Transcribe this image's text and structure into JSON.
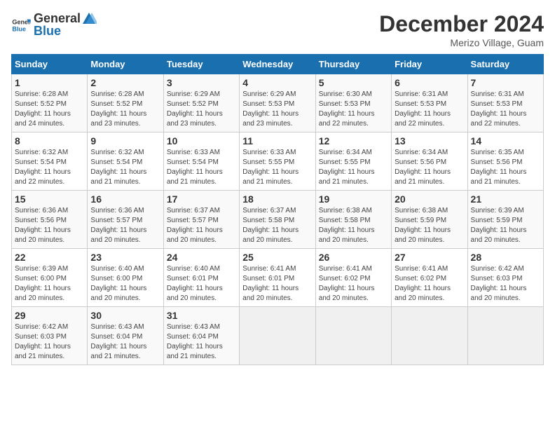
{
  "header": {
    "logo_general": "General",
    "logo_blue": "Blue",
    "month": "December 2024",
    "location": "Merizo Village, Guam"
  },
  "weekdays": [
    "Sunday",
    "Monday",
    "Tuesday",
    "Wednesday",
    "Thursday",
    "Friday",
    "Saturday"
  ],
  "weeks": [
    [
      {
        "day": "1",
        "info": "Sunrise: 6:28 AM\nSunset: 5:52 PM\nDaylight: 11 hours\nand 24 minutes."
      },
      {
        "day": "2",
        "info": "Sunrise: 6:28 AM\nSunset: 5:52 PM\nDaylight: 11 hours\nand 23 minutes."
      },
      {
        "day": "3",
        "info": "Sunrise: 6:29 AM\nSunset: 5:52 PM\nDaylight: 11 hours\nand 23 minutes."
      },
      {
        "day": "4",
        "info": "Sunrise: 6:29 AM\nSunset: 5:53 PM\nDaylight: 11 hours\nand 23 minutes."
      },
      {
        "day": "5",
        "info": "Sunrise: 6:30 AM\nSunset: 5:53 PM\nDaylight: 11 hours\nand 22 minutes."
      },
      {
        "day": "6",
        "info": "Sunrise: 6:31 AM\nSunset: 5:53 PM\nDaylight: 11 hours\nand 22 minutes."
      },
      {
        "day": "7",
        "info": "Sunrise: 6:31 AM\nSunset: 5:53 PM\nDaylight: 11 hours\nand 22 minutes."
      }
    ],
    [
      {
        "day": "8",
        "info": "Sunrise: 6:32 AM\nSunset: 5:54 PM\nDaylight: 11 hours\nand 22 minutes."
      },
      {
        "day": "9",
        "info": "Sunrise: 6:32 AM\nSunset: 5:54 PM\nDaylight: 11 hours\nand 21 minutes."
      },
      {
        "day": "10",
        "info": "Sunrise: 6:33 AM\nSunset: 5:54 PM\nDaylight: 11 hours\nand 21 minutes."
      },
      {
        "day": "11",
        "info": "Sunrise: 6:33 AM\nSunset: 5:55 PM\nDaylight: 11 hours\nand 21 minutes."
      },
      {
        "day": "12",
        "info": "Sunrise: 6:34 AM\nSunset: 5:55 PM\nDaylight: 11 hours\nand 21 minutes."
      },
      {
        "day": "13",
        "info": "Sunrise: 6:34 AM\nSunset: 5:56 PM\nDaylight: 11 hours\nand 21 minutes."
      },
      {
        "day": "14",
        "info": "Sunrise: 6:35 AM\nSunset: 5:56 PM\nDaylight: 11 hours\nand 21 minutes."
      }
    ],
    [
      {
        "day": "15",
        "info": "Sunrise: 6:36 AM\nSunset: 5:56 PM\nDaylight: 11 hours\nand 20 minutes."
      },
      {
        "day": "16",
        "info": "Sunrise: 6:36 AM\nSunset: 5:57 PM\nDaylight: 11 hours\nand 20 minutes."
      },
      {
        "day": "17",
        "info": "Sunrise: 6:37 AM\nSunset: 5:57 PM\nDaylight: 11 hours\nand 20 minutes."
      },
      {
        "day": "18",
        "info": "Sunrise: 6:37 AM\nSunset: 5:58 PM\nDaylight: 11 hours\nand 20 minutes."
      },
      {
        "day": "19",
        "info": "Sunrise: 6:38 AM\nSunset: 5:58 PM\nDaylight: 11 hours\nand 20 minutes."
      },
      {
        "day": "20",
        "info": "Sunrise: 6:38 AM\nSunset: 5:59 PM\nDaylight: 11 hours\nand 20 minutes."
      },
      {
        "day": "21",
        "info": "Sunrise: 6:39 AM\nSunset: 5:59 PM\nDaylight: 11 hours\nand 20 minutes."
      }
    ],
    [
      {
        "day": "22",
        "info": "Sunrise: 6:39 AM\nSunset: 6:00 PM\nDaylight: 11 hours\nand 20 minutes."
      },
      {
        "day": "23",
        "info": "Sunrise: 6:40 AM\nSunset: 6:00 PM\nDaylight: 11 hours\nand 20 minutes."
      },
      {
        "day": "24",
        "info": "Sunrise: 6:40 AM\nSunset: 6:01 PM\nDaylight: 11 hours\nand 20 minutes."
      },
      {
        "day": "25",
        "info": "Sunrise: 6:41 AM\nSunset: 6:01 PM\nDaylight: 11 hours\nand 20 minutes."
      },
      {
        "day": "26",
        "info": "Sunrise: 6:41 AM\nSunset: 6:02 PM\nDaylight: 11 hours\nand 20 minutes."
      },
      {
        "day": "27",
        "info": "Sunrise: 6:41 AM\nSunset: 6:02 PM\nDaylight: 11 hours\nand 20 minutes."
      },
      {
        "day": "28",
        "info": "Sunrise: 6:42 AM\nSunset: 6:03 PM\nDaylight: 11 hours\nand 20 minutes."
      }
    ],
    [
      {
        "day": "29",
        "info": "Sunrise: 6:42 AM\nSunset: 6:03 PM\nDaylight: 11 hours\nand 21 minutes."
      },
      {
        "day": "30",
        "info": "Sunrise: 6:43 AM\nSunset: 6:04 PM\nDaylight: 11 hours\nand 21 minutes."
      },
      {
        "day": "31",
        "info": "Sunrise: 6:43 AM\nSunset: 6:04 PM\nDaylight: 11 hours\nand 21 minutes."
      },
      {
        "day": "",
        "info": ""
      },
      {
        "day": "",
        "info": ""
      },
      {
        "day": "",
        "info": ""
      },
      {
        "day": "",
        "info": ""
      }
    ]
  ]
}
